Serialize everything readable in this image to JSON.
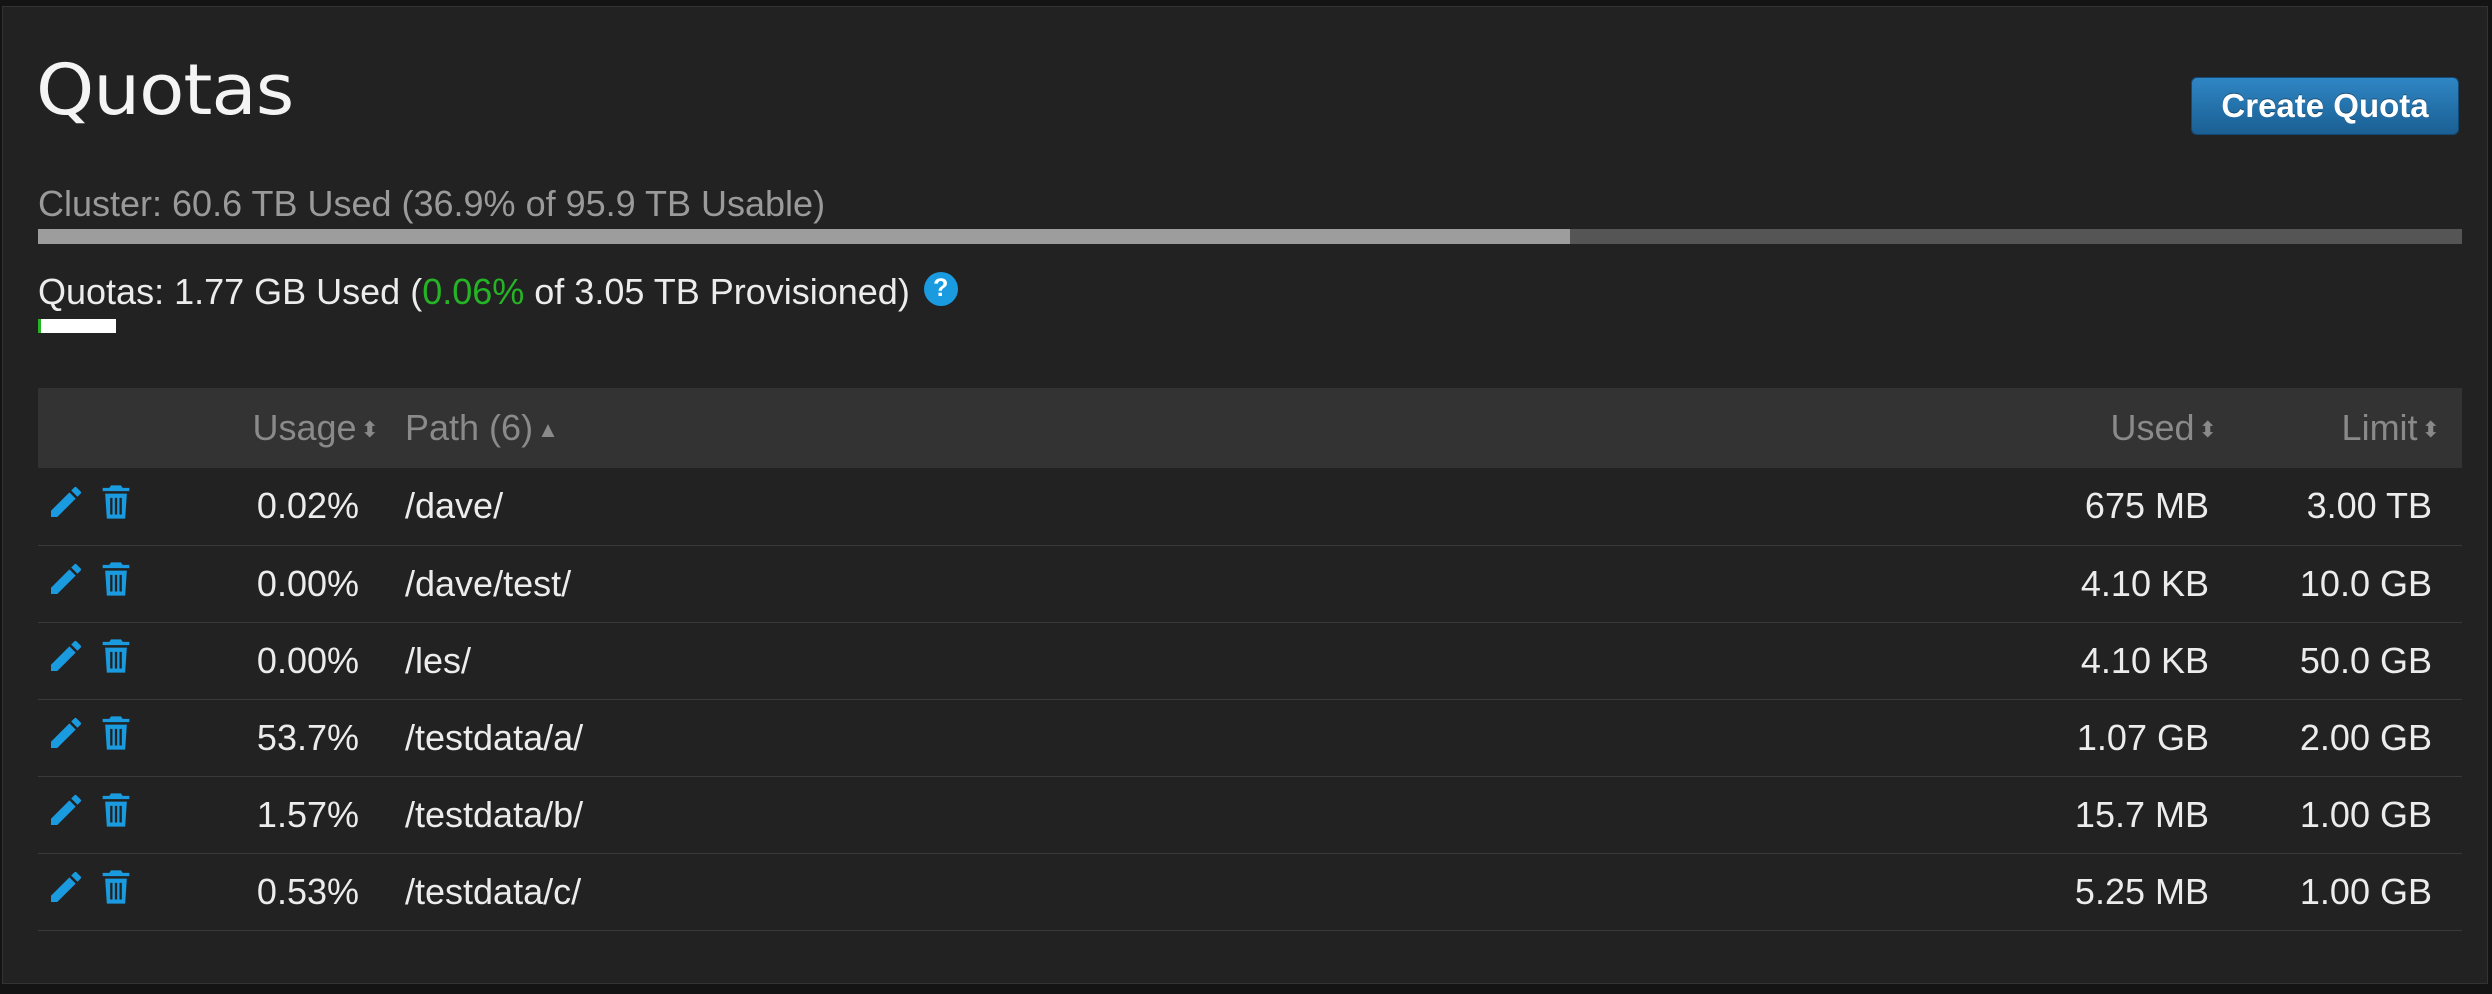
{
  "page": {
    "title": "Quotas",
    "create_button_label": "Create Quota"
  },
  "cluster": {
    "label": "Cluster: 60.6 TB Used (36.9% of 95.9 TB Usable)",
    "used_fraction": 0.632
  },
  "quotas_summary": {
    "prefix": "Quotas: 1.77 GB Used (",
    "percent": "0.06%",
    "suffix": " of 3.05 TB Provisioned)",
    "help_icon": "?",
    "used_fraction": 0.0006
  },
  "table": {
    "headers": {
      "usage": "Usage",
      "path": "Path (6)",
      "used": "Used",
      "limit": "Limit"
    },
    "rows": [
      {
        "usage": "0.02%",
        "path": "/dave/",
        "used": "675 MB",
        "limit": "3.00 TB"
      },
      {
        "usage": "0.00%",
        "path": "/dave/test/",
        "used": "4.10 KB",
        "limit": "10.0 GB"
      },
      {
        "usage": "0.00%",
        "path": "/les/",
        "used": "4.10 KB",
        "limit": "50.0 GB"
      },
      {
        "usage": "53.7%",
        "path": "/testdata/a/",
        "used": "1.07 GB",
        "limit": "2.00 GB"
      },
      {
        "usage": "1.57%",
        "path": "/testdata/b/",
        "used": "15.7 MB",
        "limit": "1.00 GB"
      },
      {
        "usage": "0.53%",
        "path": "/testdata/c/",
        "used": "5.25 MB",
        "limit": "1.00 GB"
      }
    ]
  },
  "icons": {
    "edit": "pencil-icon",
    "delete": "trash-icon",
    "sort": "sort-icon",
    "sort_asc": "sort-asc-icon",
    "help": "help-icon"
  },
  "colors": {
    "accent": "#1a9be0",
    "button": "#2479b5",
    "percent_green": "#25b425"
  }
}
